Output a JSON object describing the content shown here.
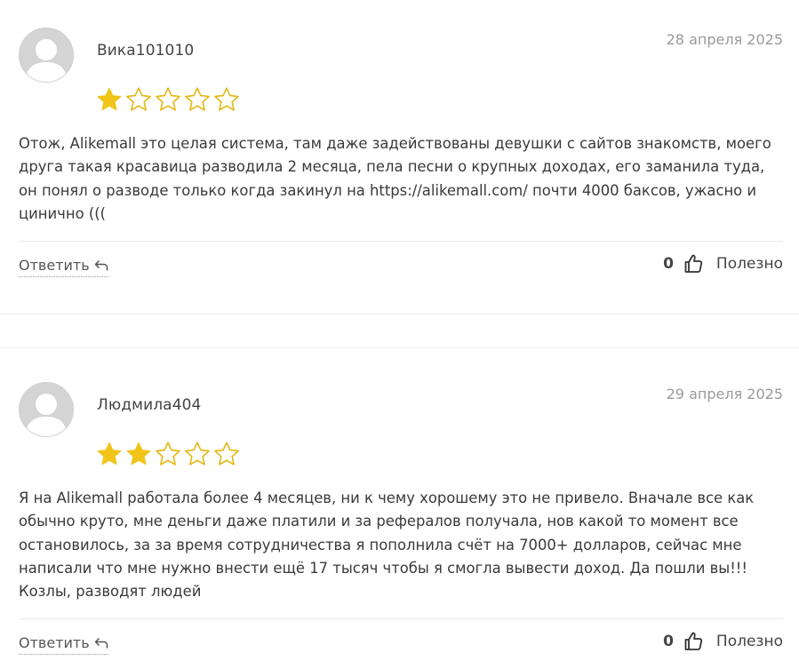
{
  "reviews": [
    {
      "author": "Вика101010",
      "date": "28 апреля 2025",
      "rating": 1,
      "max_rating": 5,
      "text": "Отож, Alikemall это целая система, там даже задействованы девушки с сайтов знакомств, моего друга такая красавица разводила 2 месяца, пела песни о крупных доходах, его заманила туда, он понял о разводе только когда закинул на https://alikemall.com/ почти 4000 баксов, ужасно и цинично (((",
      "reply_label": "Ответить",
      "helpful_count": "0",
      "helpful_label": "Полезно"
    },
    {
      "author": "Людмила404",
      "date": "29 апреля 2025",
      "rating": 2,
      "max_rating": 5,
      "text": "Я на Alikemall работала более 4 месяцев, ни к чему хорошему это не привело. Вначале все как обычно круто, мне деньги даже платили и за рефералов получала, нов какой то момент все остановилось, за за время сотрудничества я пополнила счёт на 7000+ долларов, сейчас мне написали что мне нужно внести ещё 17 тысяч чтобы я смогла вывести доход. Да пошли вы!!! Козлы, разводят людей",
      "reply_label": "Ответить",
      "helpful_count": "0",
      "helpful_label": "Полезно"
    }
  ],
  "colors": {
    "star_filled": "#f0c419",
    "star_outline": "#e2b712",
    "avatar_bg": "#d4d4d4",
    "avatar_figure": "#ffffff",
    "date_text": "#9a9a9a"
  },
  "icons": {
    "avatar": "default-user-avatar-icon",
    "star_filled": "star-filled-icon",
    "star_empty": "star-outline-icon",
    "reply": "reply-arrow-icon",
    "helpful": "thumbs-up-icon"
  }
}
